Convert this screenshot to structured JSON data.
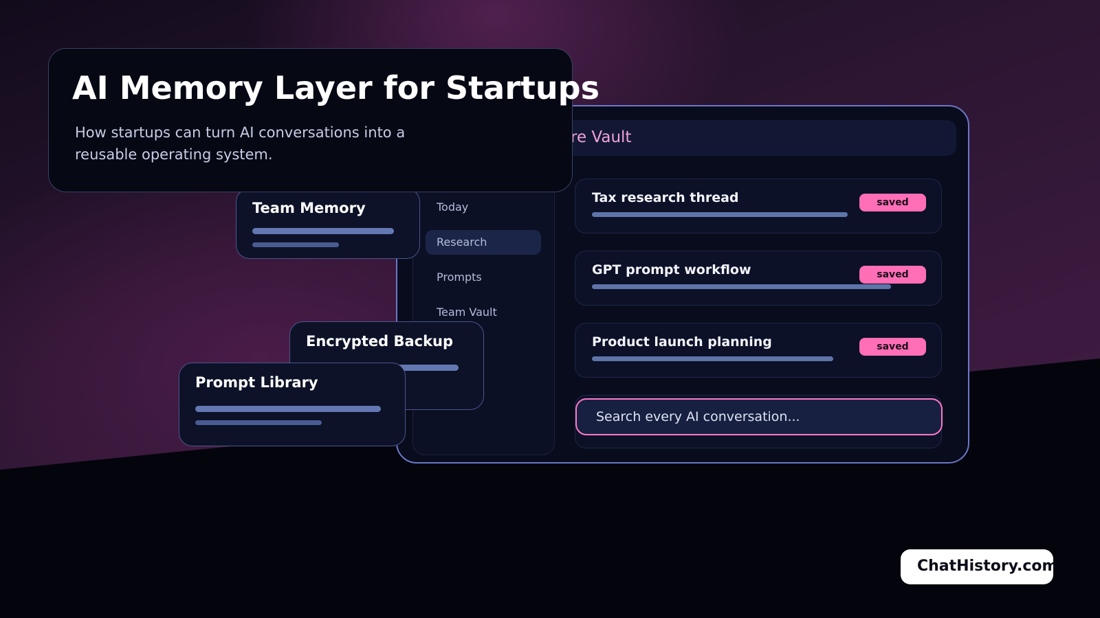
{
  "hero": {
    "title": "AI Memory Layer for Startups",
    "subtitle": "How startups can turn AI conversations into a reusable operating system."
  },
  "app": {
    "header_text": "re Vault",
    "sidebar": {
      "items": [
        {
          "label": "Today",
          "active": false
        },
        {
          "label": "Research",
          "active": true
        },
        {
          "label": "Prompts",
          "active": false
        },
        {
          "label": "Team Vault",
          "active": false
        }
      ]
    },
    "threads": [
      {
        "title": "Tax research thread",
        "badge": "saved"
      },
      {
        "title": "GPT prompt workflow",
        "badge": "saved"
      },
      {
        "title": "Product launch planning",
        "badge": "saved"
      }
    ],
    "search": {
      "placeholder": "Search every AI conversation..."
    }
  },
  "cards": {
    "team_memory": {
      "title": "Team Memory"
    },
    "encrypted_backup": {
      "title": "Encrypted Backup"
    },
    "prompt_library": {
      "title": "Prompt Library"
    }
  },
  "logo": {
    "text": "ChatHistory.com"
  },
  "colors": {
    "background": "#04050c",
    "accent_pink": "#ff6eb6",
    "panel_border": "#6c78c9",
    "bar": "#5f74a8"
  }
}
